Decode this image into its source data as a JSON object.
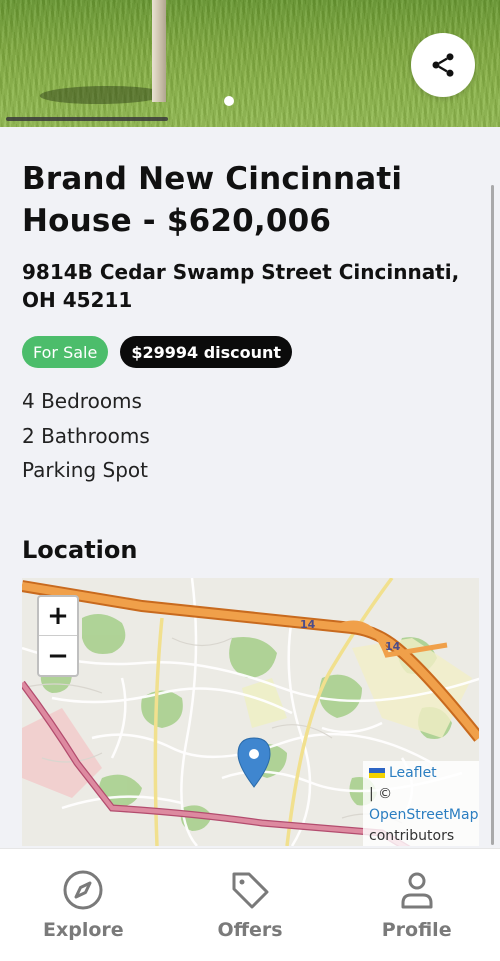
{
  "listing": {
    "title": "Brand New Cincinnati House - $620,006",
    "address": "9814B Cedar Swamp Street Cincinnati, OH 45211",
    "status_badge": "For Sale",
    "discount_badge": "$29994 discount",
    "features": [
      "4 Bedrooms",
      "2 Bathrooms",
      "Parking Spot"
    ]
  },
  "location": {
    "section_title": "Location",
    "zoom_in": "+",
    "zoom_out": "−",
    "highway_label": "14",
    "attribution": {
      "leaflet": "Leaflet",
      "separator": "| ©",
      "osm": "OpenStreetMap",
      "contributors": "contributors"
    }
  },
  "nav": {
    "items": [
      {
        "label": "Explore",
        "icon": "compass-icon"
      },
      {
        "label": "Offers",
        "icon": "tag-icon"
      },
      {
        "label": "Profile",
        "icon": "person-icon"
      }
    ]
  },
  "colors": {
    "for_sale": "#4cbd6b",
    "discount": "#0b0b0b",
    "highway": "#e8953a",
    "marker": "#3f86cf"
  }
}
